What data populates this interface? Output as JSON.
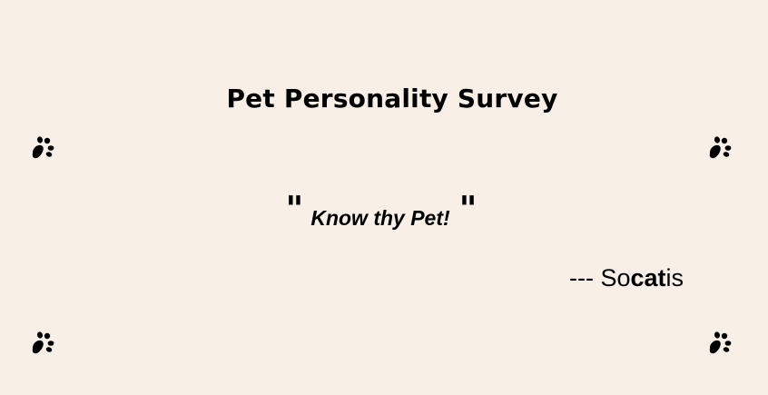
{
  "page": {
    "title": "Pet Personality Survey",
    "quote": {
      "open_mark": "\"",
      "text": "Know thy Pet!",
      "close_mark": "\""
    },
    "attribution": {
      "prefix": "--- So",
      "emphasis": "cat",
      "suffix": "is"
    },
    "decorations": [
      "paw-print-icon",
      "paw-print-icon",
      "paw-print-icon",
      "paw-print-icon"
    ]
  }
}
